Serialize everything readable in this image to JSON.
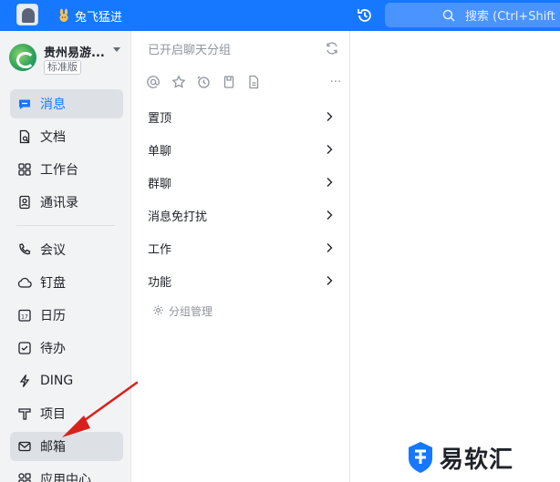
{
  "topbar": {
    "slogan": "兔飞猛进",
    "search_placeholder": "搜索 (Ctrl+Shift",
    "color": "#1677ff"
  },
  "org": {
    "name": "贵州易游...",
    "edition": "标准版"
  },
  "nav": {
    "items": [
      {
        "label": "消息",
        "icon": "chat-bubble-icon",
        "active": true
      },
      {
        "label": "文档",
        "icon": "document-icon"
      },
      {
        "label": "工作台",
        "icon": "grid-apps-icon"
      },
      {
        "label": "通讯录",
        "icon": "contacts-icon"
      },
      {
        "label": "会议",
        "icon": "phone-icon"
      },
      {
        "label": "钉盘",
        "icon": "cloud-disk-icon"
      },
      {
        "label": "日历",
        "icon": "calendar-icon"
      },
      {
        "label": "待办",
        "icon": "todo-check-icon"
      },
      {
        "label": "DING",
        "icon": "ding-lightning-icon"
      },
      {
        "label": "项目",
        "icon": "project-icon"
      },
      {
        "label": "邮箱",
        "icon": "mail-icon"
      },
      {
        "label": "应用中心",
        "icon": "app-center-icon"
      }
    ],
    "calendar_day": "17"
  },
  "groups": {
    "title": "已开启聊天分组",
    "rows": [
      "置顶",
      "单聊",
      "群聊",
      "消息免打扰",
      "工作",
      "功能"
    ],
    "manage_label": "分组管理",
    "more": "···"
  },
  "watermark": {
    "text": "易软汇"
  }
}
